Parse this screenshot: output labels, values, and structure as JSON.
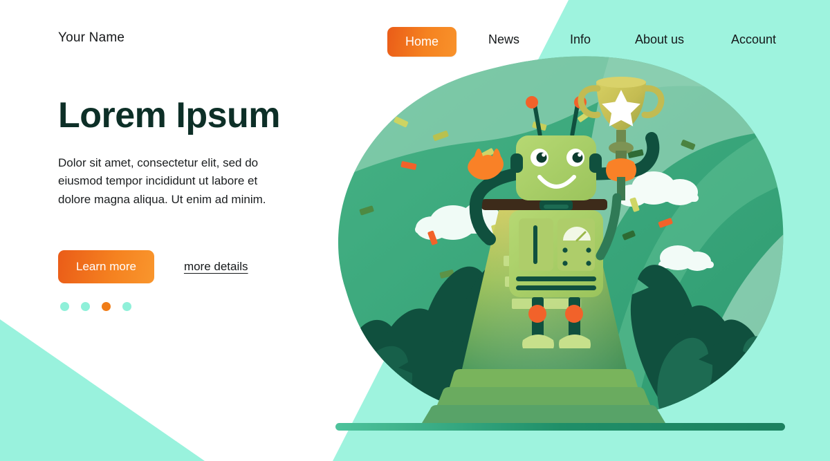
{
  "brand": {
    "name": "Your Name"
  },
  "nav": {
    "items": [
      {
        "label": "Home",
        "active": true
      },
      {
        "label": "News",
        "active": false
      },
      {
        "label": "Info",
        "active": false
      },
      {
        "label": "About us",
        "active": false
      },
      {
        "label": "Account",
        "active": false
      }
    ]
  },
  "hero": {
    "title": "Lorem Ipsum",
    "description": "Dolor sit amet, consectetur  elit, sed do eiusmod tempor incididunt ut labore et dolore magna aliqua. Ut enim ad minim.",
    "primary_button": "Learn more",
    "secondary_link": "more details",
    "carousel": {
      "count": 4,
      "active_index": 2
    }
  },
  "colors": {
    "accent_orange": "#f58220",
    "accent_orange_dark": "#ea5c18",
    "mint": "#99f2dd",
    "mint_light": "#aaf5e4",
    "heading_green": "#0d2f27",
    "blob_green": "#3aa87a",
    "blob_green_light": "#8ecfb2",
    "leaf_dark": "#0d4a3a",
    "leaf_mid": "#17614a",
    "robot_body": "#a9ce63",
    "robot_body_light": "#bada76",
    "robot_dark": "#0f4436",
    "trophy_gold": "#c9c257",
    "podium_top": "#3d2b1a",
    "white": "#ffffff"
  },
  "illustration": {
    "name": "robot-with-trophy-on-podium",
    "elements": [
      "award-robot",
      "gold-trophy-with-star",
      "winner-podium",
      "tropical-leaves",
      "clouds",
      "confetti"
    ]
  }
}
